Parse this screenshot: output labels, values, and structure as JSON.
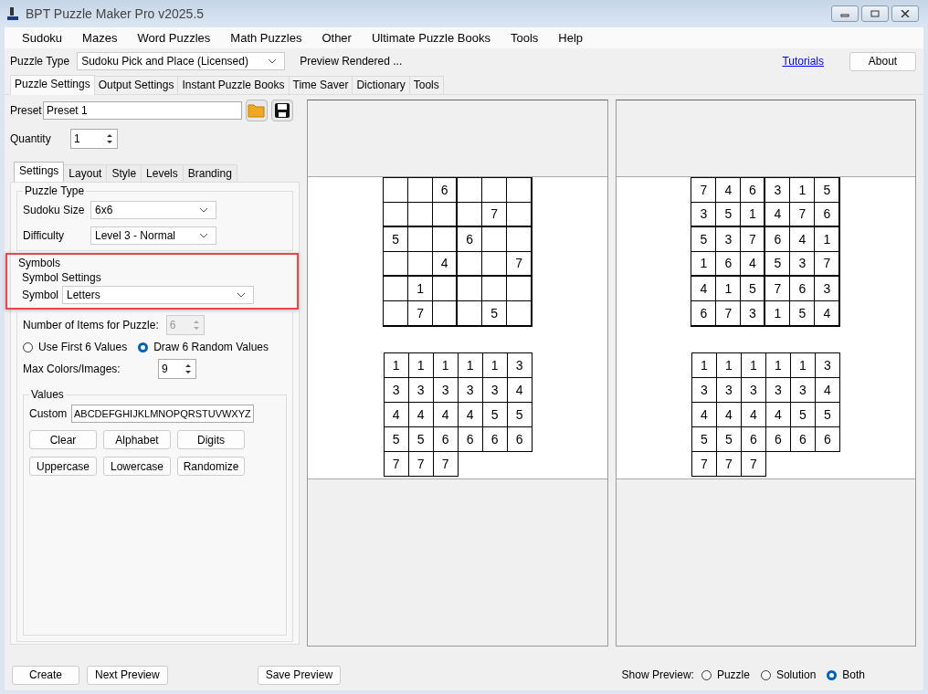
{
  "window": {
    "title": "BPT Puzzle Maker Pro v2025.5"
  },
  "menu": [
    "Sudoku",
    "Mazes",
    "Word Puzzles",
    "Math Puzzles",
    "Other",
    "Ultimate Puzzle Books",
    "Tools",
    "Help"
  ],
  "toolbar": {
    "puzzle_type_label": "Puzzle Type",
    "puzzle_type": "Sudoku Pick and Place (Licensed)",
    "status": "Preview Rendered ...",
    "tutorials_link": "Tutorials",
    "about_button": "About"
  },
  "tabs": [
    {
      "label": "Puzzle Settings",
      "selected": true
    },
    {
      "label": "Output Settings",
      "selected": false
    },
    {
      "label": "Instant Puzzle Books",
      "selected": false
    },
    {
      "label": "Time Saver",
      "selected": false
    },
    {
      "label": "Dictionary",
      "selected": false
    },
    {
      "label": "Tools",
      "selected": false
    }
  ],
  "preset": {
    "label": "Preset",
    "value": "Preset 1"
  },
  "quantity": {
    "label": "Quantity",
    "value": "1"
  },
  "sub_tabs": [
    {
      "label": "Settings",
      "selected": true
    },
    {
      "label": "Layout",
      "selected": false
    },
    {
      "label": "Style",
      "selected": false
    },
    {
      "label": "Levels",
      "selected": false
    },
    {
      "label": "Branding",
      "selected": false
    }
  ],
  "puzzle_type_group": {
    "title": "Puzzle Type",
    "size_label": "Sudoku Size",
    "size": "6x6",
    "difficulty_label": "Difficulty",
    "difficulty": "Level 3 - Normal"
  },
  "symbols_group": {
    "title": "Symbols",
    "settings_title": "Symbol Settings",
    "symbol_label": "Symbol",
    "symbol": "Letters",
    "items_label": "Number of Items for Puzzle:",
    "items_value": "6",
    "items_disabled": true,
    "radios": [
      {
        "label": "Use First 6 Values",
        "selected": false
      },
      {
        "label": "Draw 6 Random Values",
        "selected": true
      }
    ],
    "max_label": "Max Colors/Images:",
    "max_value": "9"
  },
  "values_group": {
    "title": "Values",
    "custom_label": "Custom",
    "custom": "ABCDEFGHIJKLMNOPQRSTUVWXYZ",
    "buttons": [
      "Clear",
      "Alphabet",
      "Digits",
      "Uppercase",
      "Lowercase",
      "Randomize"
    ]
  },
  "previews": [
    {
      "grid": [
        {
          "c3": "6"
        },
        {
          "c5": "7"
        },
        {
          "c1": "5",
          "c4": "6"
        },
        {
          "c3": "4",
          "c6": "7"
        },
        {
          "c2": "1"
        },
        {
          "c2": "7",
          "c5": "5"
        }
      ],
      "pieces": [
        [
          "1",
          "1",
          "1",
          "1",
          "1",
          "3"
        ],
        [
          "3",
          "3",
          "3",
          "3",
          "3",
          "4"
        ],
        [
          "4",
          "4",
          "4",
          "4",
          "5",
          "5"
        ],
        [
          "5",
          "5",
          "6",
          "6",
          "6",
          "6"
        ],
        [
          "7",
          "7",
          "7"
        ]
      ]
    },
    {
      "grid": [
        {
          "c1": "7",
          "c2": "4",
          "c3": "6",
          "c4": "3",
          "c5": "1",
          "c6": "5"
        },
        {
          "c1": "3",
          "c2": "5",
          "c3": "1",
          "c4": "4",
          "c5": "7",
          "c6": "6"
        },
        {
          "c1": "5",
          "c2": "3",
          "c3": "7",
          "c4": "6",
          "c5": "4",
          "c6": "1"
        },
        {
          "c1": "1",
          "c2": "6",
          "c3": "4",
          "c4": "5",
          "c5": "3",
          "c6": "7"
        },
        {
          "c1": "4",
          "c2": "1",
          "c3": "5",
          "c4": "7",
          "c5": "6",
          "c6": "3"
        },
        {
          "c1": "6",
          "c2": "7",
          "c3": "3",
          "c4": "1",
          "c5": "5",
          "c6": "4"
        }
      ],
      "pieces": [
        [
          "1",
          "1",
          "1",
          "1",
          "1",
          "3"
        ],
        [
          "3",
          "3",
          "3",
          "3",
          "3",
          "4"
        ],
        [
          "4",
          "4",
          "4",
          "4",
          "5",
          "5"
        ],
        [
          "5",
          "5",
          "6",
          "6",
          "6",
          "6"
        ],
        [
          "7",
          "7",
          "7"
        ]
      ]
    }
  ],
  "bottom": {
    "buttons": [
      "Create",
      "Next Preview",
      "Save Preview"
    ],
    "show_label": "Show Preview:",
    "options": [
      {
        "label": "Puzzle",
        "selected": false
      },
      {
        "label": "Solution",
        "selected": false
      },
      {
        "label": "Both",
        "selected": true
      }
    ]
  }
}
